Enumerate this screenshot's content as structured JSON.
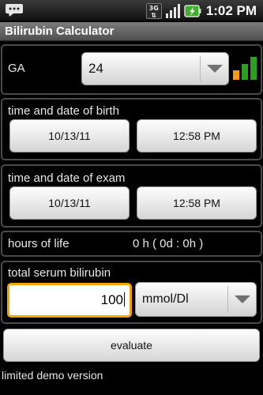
{
  "status_bar": {
    "network_label": "3G",
    "time": "1:02 PM",
    "icons": [
      "message-icon",
      "3g-icon",
      "signal-icon",
      "battery-charging-icon"
    ]
  },
  "app": {
    "title": "Bilirubin Calculator"
  },
  "ga": {
    "label": "GA",
    "selected_value": "24",
    "icon": "bar-chart-icon"
  },
  "birth": {
    "label": "time and date of birth",
    "date": "10/13/11",
    "time": "12:58 PM"
  },
  "exam": {
    "label": "time and date of exam",
    "date": "10/13/11",
    "time": "12:58 PM"
  },
  "hours_of_life": {
    "label": "hours of life",
    "value": "0 h ( 0d : 0h )"
  },
  "bilirubin": {
    "label": "total serum bilirubin",
    "input_value": "100",
    "unit_selected": "mmol/Dl"
  },
  "actions": {
    "evaluate_label": "evaluate"
  },
  "footer": {
    "note": "limited demo version"
  },
  "colors": {
    "focus_ring": "#f2a400",
    "chart_green": "#2e9e22",
    "chart_orange": "#f29a1a"
  }
}
